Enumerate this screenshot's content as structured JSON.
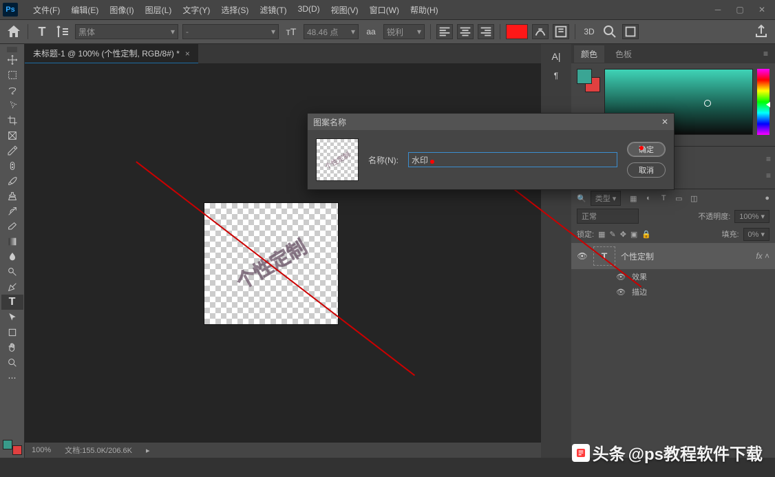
{
  "menu": {
    "file": "文件(F)",
    "edit": "编辑(E)",
    "image": "图像(I)",
    "layer": "图层(L)",
    "type": "文字(Y)",
    "select": "选择(S)",
    "filter": "滤镜(T)",
    "three_d": "3D(D)",
    "view": "视图(V)",
    "window": "窗口(W)",
    "help": "帮助(H)"
  },
  "options": {
    "font": "黑体",
    "style": "-",
    "size": "48.46 点",
    "aa": "aa",
    "sharpness": "锐利",
    "three_d_label": "3D"
  },
  "doc": {
    "tab_title": "未标题-1 @ 100% (个性定制, RGB/8#) *",
    "watermark_text": "个性定制",
    "zoom": "100%",
    "file_info": "文档:155.0K/206.6K"
  },
  "panels": {
    "color_tab": "颜色",
    "swatches_tab": "色板",
    "layer_search": "类型",
    "blend_mode": "正常",
    "opacity_label": "不透明度:",
    "opacity_value": "100%",
    "lock_label": "锁定:",
    "fill_label": "填充:",
    "fill_value": "0%",
    "layer_name": "个性定制",
    "fx_label": "fx",
    "effects_label": "效果",
    "stroke_label": "描边"
  },
  "dialog": {
    "title": "图案名称",
    "field_label": "名称(N):",
    "field_value": "水印",
    "ok": "确定",
    "cancel": "取消",
    "thumb_text": "个性定制"
  },
  "credit": {
    "text": "@ps教程软件下载",
    "prefix": "头条"
  }
}
